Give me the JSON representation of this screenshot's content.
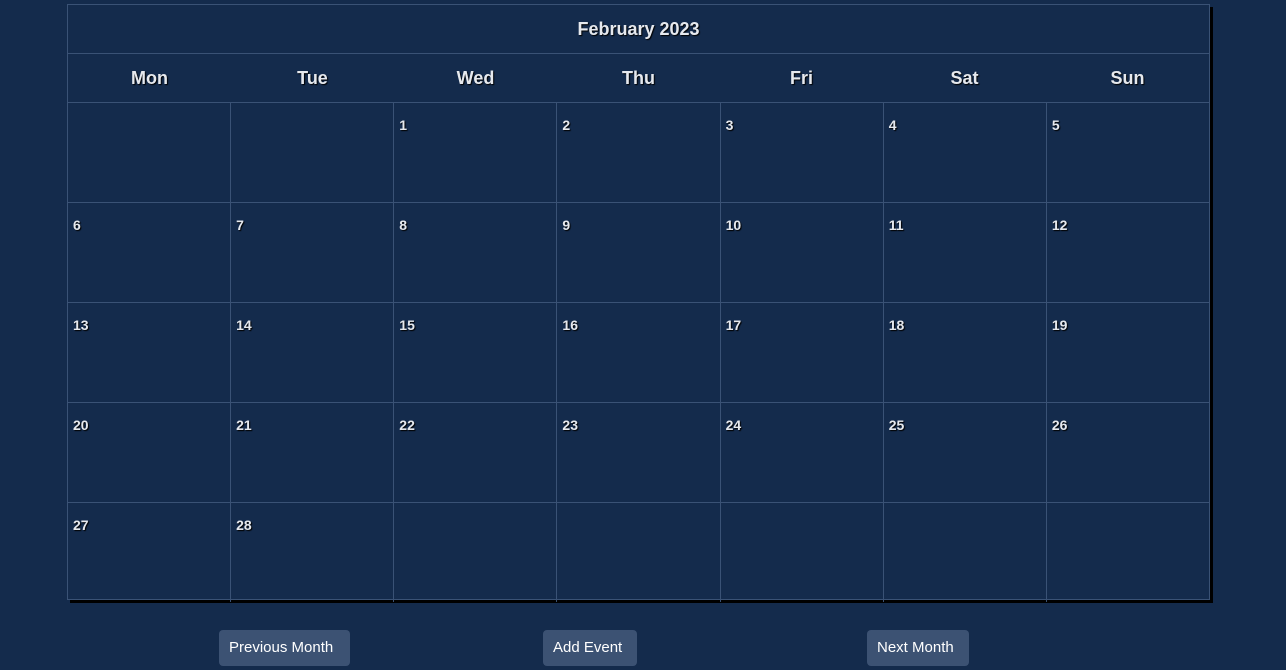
{
  "calendar": {
    "title": "February 2023",
    "weekdays": [
      "Mon",
      "Tue",
      "Wed",
      "Thu",
      "Fri",
      "Sat",
      "Sun"
    ],
    "weeks": [
      [
        "",
        "",
        "1",
        "2",
        "3",
        "4",
        "5"
      ],
      [
        "6",
        "7",
        "8",
        "9",
        "10",
        "11",
        "12"
      ],
      [
        "13",
        "14",
        "15",
        "16",
        "17",
        "18",
        "19"
      ],
      [
        "20",
        "21",
        "22",
        "23",
        "24",
        "25",
        "26"
      ],
      [
        "27",
        "28",
        "",
        "",
        "",
        "",
        ""
      ]
    ]
  },
  "controls": {
    "prev_label": "Previous Month",
    "add_label": "Add Event",
    "next_label": "Next Month"
  },
  "colors": {
    "background": "#142b4c",
    "grid_line": "#3a5275",
    "button": "#3c5273",
    "text": "#e6e9ee"
  }
}
